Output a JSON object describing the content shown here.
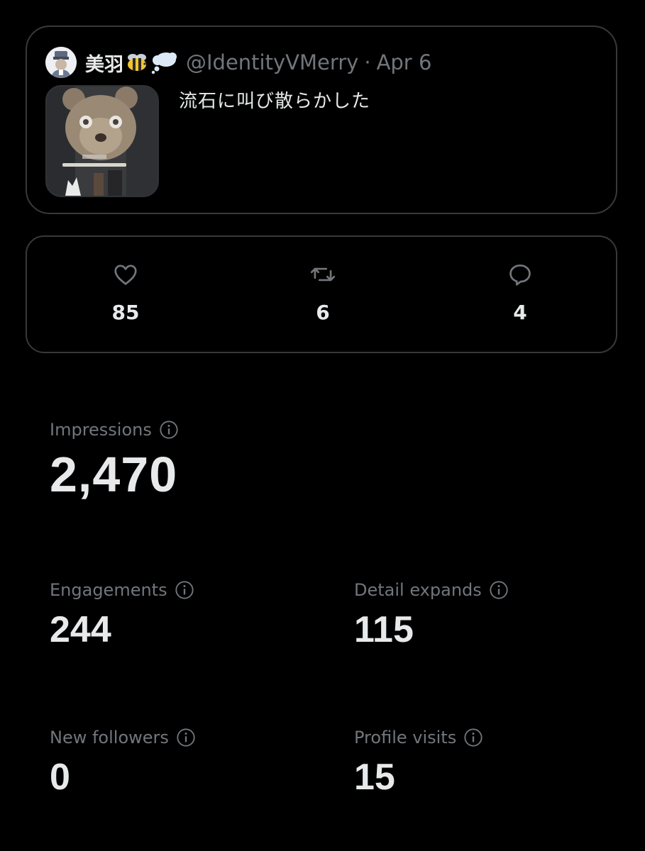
{
  "tweet": {
    "display_name": "美羽",
    "handle": "@IdentityVMerry",
    "separator": "·",
    "date": "Apr 6",
    "text": "流石に叫び散らかした",
    "emoji_icons": [
      "bee-icon",
      "thought-bubble-icon"
    ]
  },
  "engagement": {
    "likes": {
      "icon": "heart-icon",
      "count": "85"
    },
    "retweets": {
      "icon": "retweet-icon",
      "count": "6"
    },
    "replies": {
      "icon": "reply-icon",
      "count": "4"
    }
  },
  "stats": {
    "impressions": {
      "label": "Impressions",
      "value": "2,470"
    },
    "engagements": {
      "label": "Engagements",
      "value": "244"
    },
    "detail_expands": {
      "label": "Detail expands",
      "value": "115"
    },
    "new_followers": {
      "label": "New followers",
      "value": "0"
    },
    "profile_visits": {
      "label": "Profile visits",
      "value": "15"
    }
  },
  "colors": {
    "background": "#000000",
    "border": "#38393d",
    "primary_text": "#e7e9ea",
    "secondary_text": "#71767b"
  }
}
